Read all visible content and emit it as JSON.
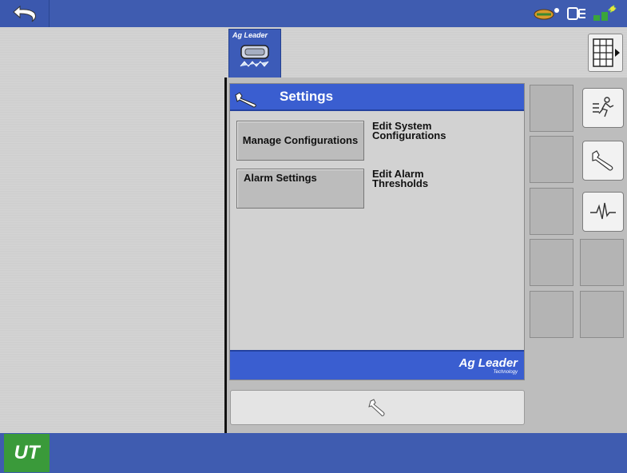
{
  "header": {
    "back_icon": "back-arrow-icon",
    "status_icons": [
      "implement-status-icon",
      "display-link-icon",
      "gps-signal-icon"
    ]
  },
  "tab": {
    "label": "Ag Leader",
    "icon": "serial-connector-icon"
  },
  "settings": {
    "title": "Settings",
    "items": [
      {
        "button": "Manage Configurations",
        "description": "Edit System Configurations"
      },
      {
        "button": "Alarm Settings",
        "description": "Edit Alarm Thresholds"
      }
    ],
    "footer_logo": "Ag Leader",
    "footer_sub": "Technology"
  },
  "right_buttons": [
    "exit-run-icon",
    "wrench-icon",
    "diagnostics-waveform-icon"
  ],
  "bottom": {
    "logo": "UT",
    "wrench_icon": "wrench-icon"
  },
  "colors": {
    "bar_blue": "#3f5cb0",
    "header_blue": "#3a5ed0",
    "logo_green": "#3a9a3a"
  }
}
